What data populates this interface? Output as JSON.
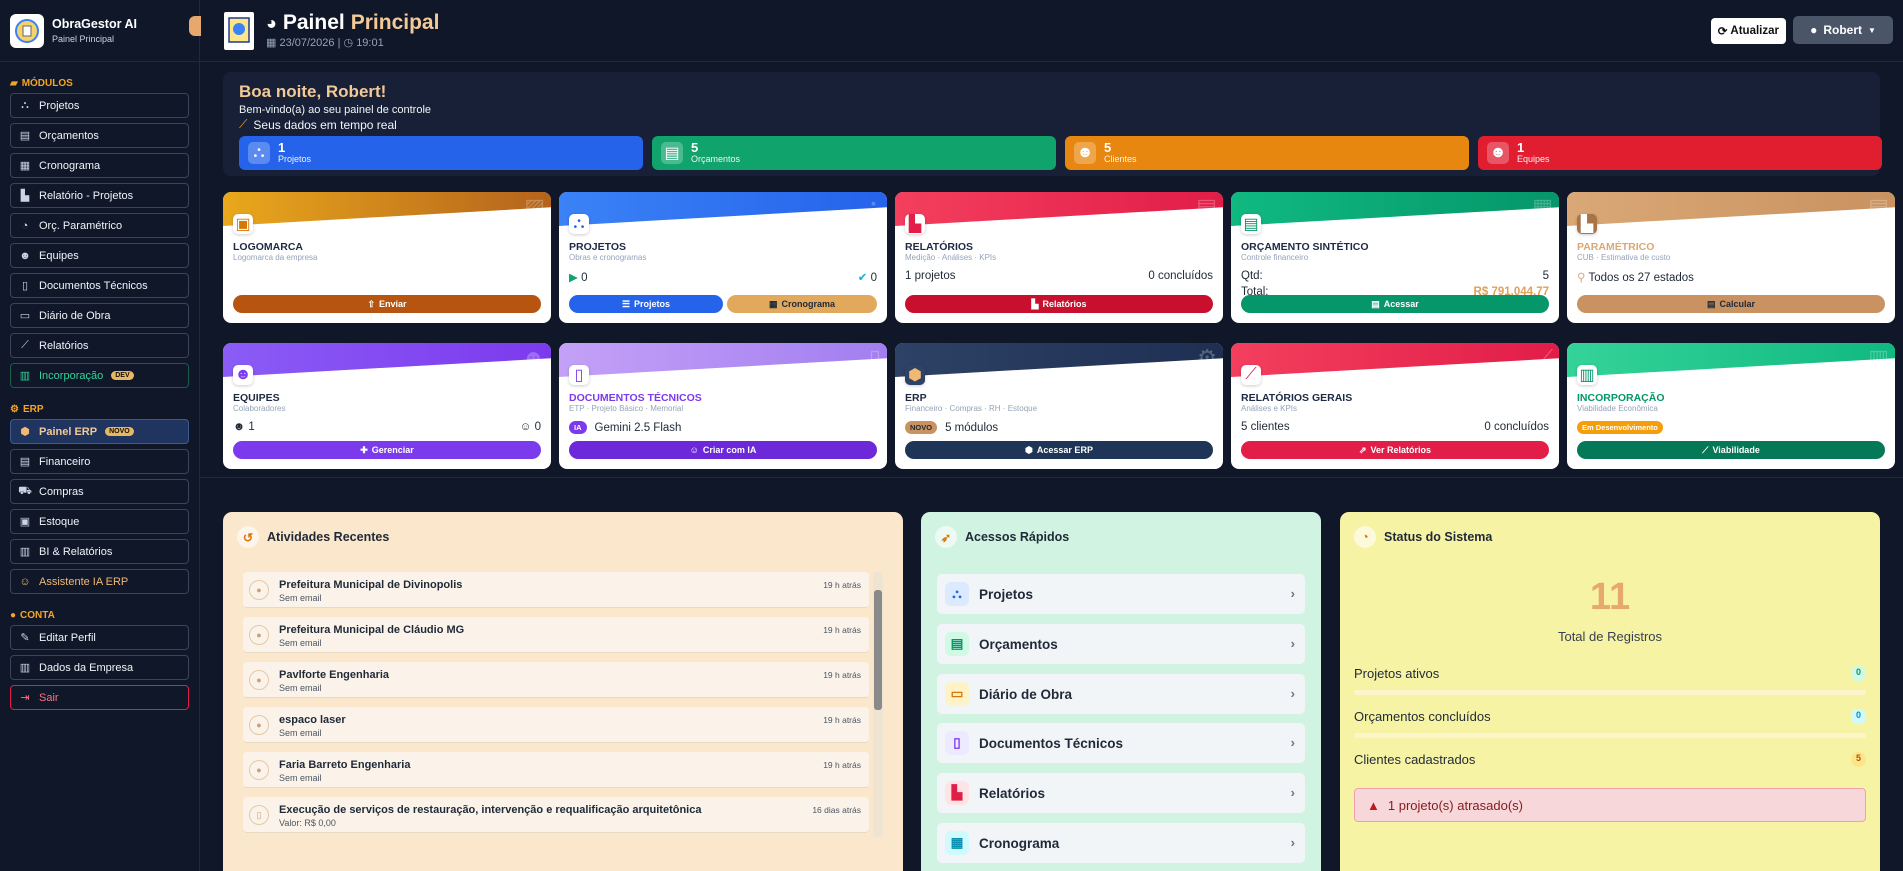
{
  "brand": {
    "title": "ObraGestor AI",
    "subtitle": "Painel Principal"
  },
  "sidebar": {
    "section_modules": "MÓDULOS",
    "modules": [
      {
        "label": "Projetos",
        "icon": "project-diagram-icon"
      },
      {
        "label": "Orçamentos",
        "icon": "calculator-icon"
      },
      {
        "label": "Cronograma",
        "icon": "calendar-icon"
      },
      {
        "label": "Relatório - Projetos",
        "icon": "chart-icon"
      },
      {
        "label": "Orç. Paramétrico",
        "icon": "gauge-icon"
      },
      {
        "label": "Equipes",
        "icon": "users-icon"
      },
      {
        "label": "Documentos Técnicos",
        "icon": "document-icon"
      },
      {
        "label": "Diário de Obra",
        "icon": "book-icon"
      },
      {
        "label": "Relatórios",
        "icon": "line-chart-icon"
      },
      {
        "label": "Incorporação",
        "icon": "building-icon",
        "badge": "DEV"
      }
    ],
    "section_erp": "ERP",
    "erp": [
      {
        "label": "Painel ERP",
        "icon": "cubes-icon",
        "badge": "NOVO"
      },
      {
        "label": "Financeiro",
        "icon": "money-icon"
      },
      {
        "label": "Compras",
        "icon": "cart-icon"
      },
      {
        "label": "Estoque",
        "icon": "boxes-icon"
      },
      {
        "label": "BI & Relatórios",
        "icon": "bi-icon"
      },
      {
        "label": "Assistente IA ERP",
        "icon": "robot-icon"
      }
    ],
    "section_account": "CONTA",
    "account": [
      {
        "label": "Editar Perfil",
        "icon": "user-edit-icon"
      },
      {
        "label": "Dados da Empresa",
        "icon": "building-icon"
      },
      {
        "label": "Sair",
        "icon": "logout-icon"
      }
    ]
  },
  "header": {
    "title_a": "Painel",
    "title_b": "Principal",
    "date": "23/07/2026",
    "time": "19:01",
    "refresh": "Atualizar",
    "user": "Robert"
  },
  "hero": {
    "greeting": "Boa noite, Robert!",
    "welcome": "Bem-vindo(a) ao seu painel de controle",
    "live": "Seus dados em tempo real",
    "stats": [
      {
        "value": "1",
        "label": "Projetos",
        "color": "#2563eb"
      },
      {
        "value": "5",
        "label": "Orçamentos",
        "color": "#10a36b"
      },
      {
        "value": "5",
        "label": "Clientes",
        "color": "#e8870f"
      },
      {
        "value": "1",
        "label": "Equipes",
        "color": "#e11d30"
      }
    ]
  },
  "cards": {
    "logomarca": {
      "title": "LOGOMARCA",
      "sub": "Logomarca da empresa",
      "btn": "Enviar"
    },
    "projetos": {
      "title": "PROJETOS",
      "sub": "Obras e cronogramas",
      "left": "0",
      "right": "0",
      "btn1": "Projetos",
      "btn2": "Cronograma"
    },
    "relatorios": {
      "title": "RELATÓRIOS",
      "sub": "Medição · Análises · KPIs",
      "left": "1 projetos",
      "right": "0 concluídos",
      "btn": "Relatórios"
    },
    "orcamento": {
      "title": "ORÇAMENTO SINTÉTICO",
      "sub": "Controle financeiro",
      "qtd_label": "Qtd:",
      "qtd": "5",
      "total_label": "Total:",
      "total": "R$ 791.044,77",
      "btn": "Acessar"
    },
    "parametrico": {
      "title": "PARAMÉTRICO",
      "sub": "CUB · Estimativa de custo",
      "info": "Todos os 27 estados",
      "btn": "Calcular"
    },
    "equipes": {
      "title": "EQUIPES",
      "sub": "Colaboradores",
      "left": "1",
      "right": "0",
      "btn": "Gerenciar"
    },
    "documentos": {
      "title": "DOCUMENTOS TÉCNICOS",
      "sub": "ETP · Projeto Básico · Memorial",
      "tag": "IA",
      "info": "Gemini 2.5 Flash",
      "btn": "Criar com IA"
    },
    "erp": {
      "title": "ERP",
      "sub": "Financeiro · Compras · RH · Estoque",
      "tag": "NOVO",
      "info": "5 módulos",
      "btn": "Acessar ERP"
    },
    "relgerais": {
      "title": "RELATÓRIOS GERAIS",
      "sub": "Análises e KPIs",
      "left": "5 clientes",
      "right": "0 concluídos",
      "btn": "Ver Relatórios"
    },
    "incorporacao": {
      "title": "INCORPORAÇÃO",
      "sub": "Viabilidade Econômica",
      "tag": "Em Desenvolvimento",
      "btn": "Viabilidade"
    }
  },
  "activities": {
    "title": "Atividades Recentes",
    "items": [
      {
        "name": "Prefeitura Municipal de Divinopolis",
        "detail": "Sem email",
        "time": "19 h atrás"
      },
      {
        "name": "Prefeitura Municipal de Cláudio MG",
        "detail": "Sem email",
        "time": "19 h atrás"
      },
      {
        "name": "Pavlforte Engenharia",
        "detail": "Sem email",
        "time": "19 h atrás"
      },
      {
        "name": "espaco laser",
        "detail": "Sem email",
        "time": "19 h atrás"
      },
      {
        "name": "Faria Barreto Engenharia",
        "detail": "Sem email",
        "time": "19 h atrás"
      },
      {
        "name": "Execução de serviços de restauração, intervenção e requalificação arquitetônica",
        "detail": "Valor: R$ 0,00",
        "time": "16 dias atrás"
      }
    ]
  },
  "quick": {
    "title": "Acessos Rápidos",
    "items": [
      {
        "label": "Projetos",
        "icon": "project-diagram-icon"
      },
      {
        "label": "Orçamentos",
        "icon": "calculator-icon"
      },
      {
        "label": "Diário de Obra",
        "icon": "book-icon"
      },
      {
        "label": "Documentos Técnicos",
        "icon": "document-icon"
      },
      {
        "label": "Relatórios",
        "icon": "chart-icon"
      },
      {
        "label": "Cronograma",
        "icon": "calendar-icon"
      }
    ]
  },
  "system": {
    "title": "Status do Sistema",
    "total": "11",
    "total_label": "Total de Registros",
    "rows": [
      {
        "label": "Projetos ativos",
        "value": "0"
      },
      {
        "label": "Orçamentos concluídos",
        "value": "0"
      },
      {
        "label": "Clientes cadastrados",
        "value": "5"
      }
    ],
    "alert": "1 projeto(s) atrasado(s)"
  }
}
